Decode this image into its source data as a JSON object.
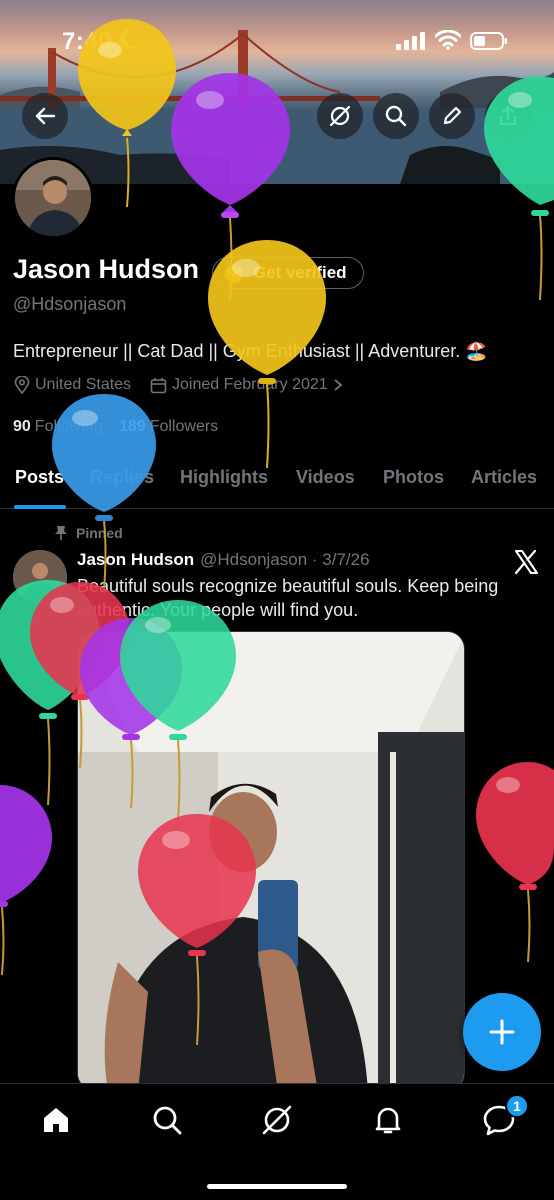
{
  "status_bar": {
    "time": "7:40"
  },
  "profile": {
    "name": "Jason Hudson",
    "verify_label": "Get verified",
    "handle": "@Hdsonjason",
    "bio": "Entrepreneur || Cat Dad || Gym Enthusiast || Adventurer. 🏖️",
    "location": "United States",
    "joined": "Joined February 2021",
    "following_count": "90",
    "following_label": "Following",
    "followers_count": "189",
    "followers_label": "Followers"
  },
  "tabs": [
    "Posts",
    "Replies",
    "Highlights",
    "Videos",
    "Photos",
    "Articles"
  ],
  "active_tab": "Posts",
  "post": {
    "pinned_label": "Pinned",
    "author": "Jason Hudson",
    "meta": "@Hdsonjason · 3/7/26",
    "text": "Beautiful souls recognize beautiful souls. Keep being authentic. Your people will find you."
  },
  "notifications_badge": "1",
  "icons": {
    "header": [
      "back-arrow-icon",
      "grok-icon",
      "search-icon",
      "edit-icon",
      "share-icon"
    ],
    "nav": [
      "home-icon",
      "search-icon",
      "grok-icon",
      "bell-icon",
      "messages-icon"
    ],
    "fab": "plus-icon"
  },
  "colors": {
    "accent": "#1d9bf0",
    "balloons": [
      "#f2c419",
      "#a434e8",
      "#2fd89a",
      "#3a9be8",
      "#e8344e"
    ]
  }
}
